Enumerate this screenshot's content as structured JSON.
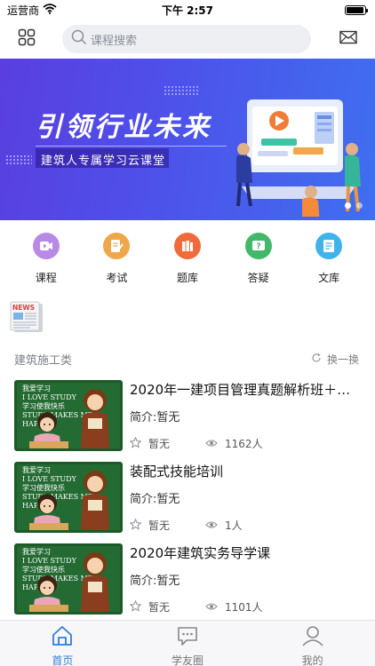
{
  "status_bar": {
    "carrier": "运营商",
    "time": "下午 2:57",
    "battery_level": 0.95
  },
  "header": {
    "search_placeholder": "课程搜索",
    "left_icon": "grid-icon",
    "right_icon": "mail-icon"
  },
  "banner": {
    "title": "引领行业未来",
    "subtitle": "建筑人专属学习云课堂",
    "page_count": 2,
    "active_page": 1
  },
  "categories": [
    {
      "label": "课程",
      "icon": "video-icon",
      "color": "#b88ae6"
    },
    {
      "label": "考试",
      "icon": "exam-icon",
      "color": "#f0a64a"
    },
    {
      "label": "题库",
      "icon": "books-icon",
      "color": "#f06b3c"
    },
    {
      "label": "答疑",
      "icon": "question-icon",
      "color": "#43b86a"
    },
    {
      "label": "文库",
      "icon": "library-icon",
      "color": "#3fb3ea"
    }
  ],
  "news_label": "NEWS",
  "section": {
    "title": "建筑施工类",
    "refresh_label": "换一换"
  },
  "course_thumb_text": [
    "我爱学习",
    "I LOVE STUDY",
    "学习使我快乐",
    "STUDY MAKES ME",
    "HAPPY"
  ],
  "courses": [
    {
      "title": "2020年一建项目管理真题解析班＋…",
      "intro": "简介:暂无",
      "rating": "暂无",
      "views": "1162人"
    },
    {
      "title": "装配式技能培训",
      "intro": "简介:暂无",
      "rating": "暂无",
      "views": "1人"
    },
    {
      "title": "2020年建筑实务导学课",
      "intro": "简介:暂无",
      "rating": "暂无",
      "views": "1101人"
    }
  ],
  "tabbar": {
    "tabs": [
      {
        "label": "首页",
        "icon": "home-icon",
        "active": true
      },
      {
        "label": "学友圈",
        "icon": "chat-icon",
        "active": false
      },
      {
        "label": "我的",
        "icon": "user-icon",
        "active": false
      }
    ],
    "active_color": "#2f7dd9"
  }
}
